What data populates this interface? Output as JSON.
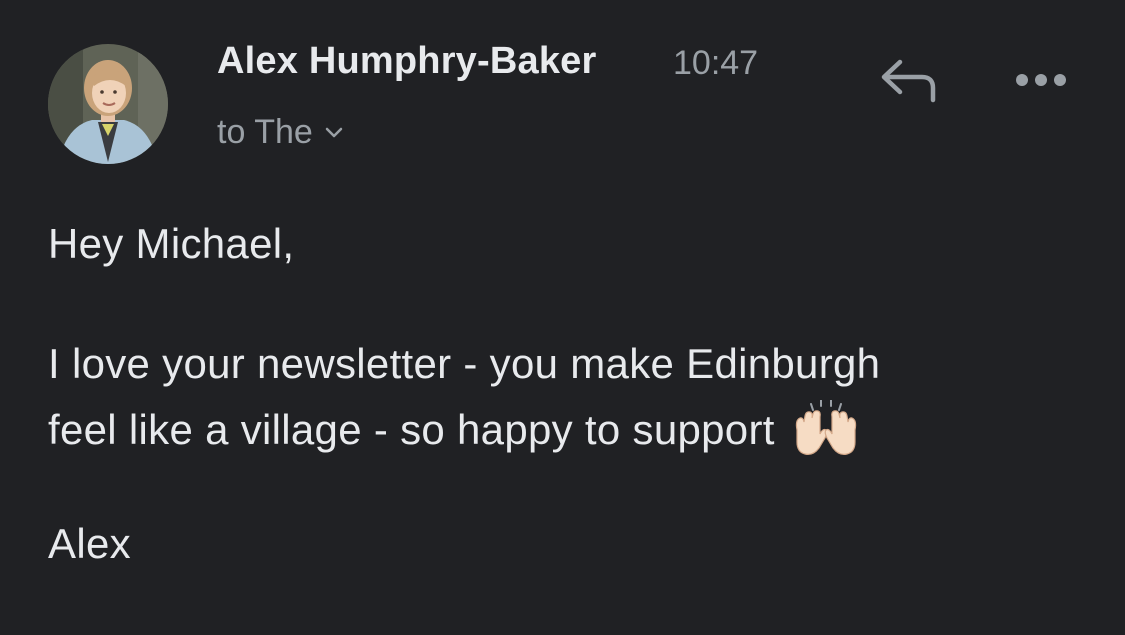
{
  "message": {
    "sender_name": "Alex Humphry-Baker",
    "time": "10:47",
    "recipient": "to The",
    "greeting": "Hey Michael,",
    "body_line1": "I love your newsletter - you make Edinburgh",
    "body_line2": "feel like a village - so happy to support",
    "signoff": "Alex",
    "emoji": "raising-hands-emoji"
  },
  "icons": {
    "reply": "reply-icon",
    "more": "more-options-icon",
    "recipient_toggle": "chevron-down-icon"
  },
  "colors": {
    "background": "#202124",
    "primary_text": "#e8eaed",
    "secondary_text": "#9aa0a6"
  }
}
